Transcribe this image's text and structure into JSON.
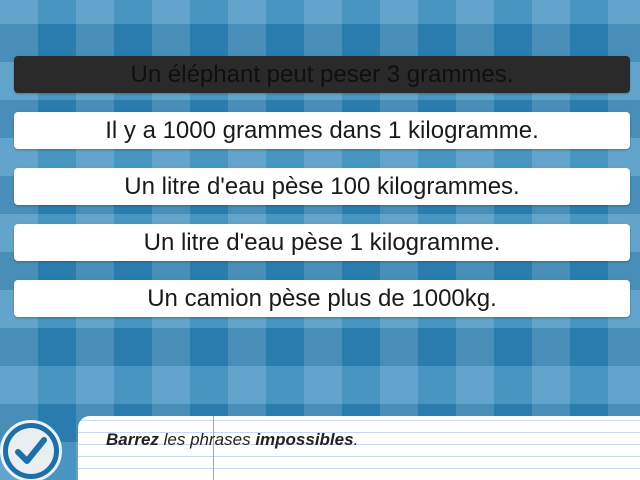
{
  "phrases": [
    {
      "text": "Un éléphant peut peser 3 grammes.",
      "selected": true
    },
    {
      "text": "Il y a 1000 grammes dans 1 kilogramme.",
      "selected": false
    },
    {
      "text": "Un litre d'eau pèse 100 kilogrammes.",
      "selected": false
    },
    {
      "text": "Un litre d'eau pèse 1 kilogramme.",
      "selected": false
    },
    {
      "text": "Un camion pèse plus de 1000kg.",
      "selected": false
    }
  ],
  "instruction": {
    "word1": "Barrez",
    "word2": " les phrases ",
    "word3": "impossibles",
    "word4": "."
  },
  "check_button": {
    "icon": "checkmark-icon"
  },
  "colors": {
    "background": "#2f86b9",
    "selected_phrase": "#2a2a2a",
    "phrase": "#ffffff",
    "check_button": "#1e6fa8"
  }
}
